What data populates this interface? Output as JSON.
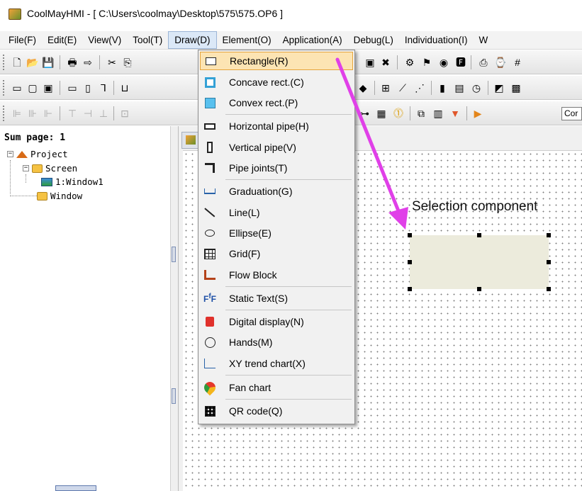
{
  "window": {
    "title": "CoolMayHMI - [ C:\\Users\\coolmay\\Desktop\\575\\575.OP6 ]"
  },
  "menubar": {
    "items": [
      {
        "label": "File(F)"
      },
      {
        "label": "Edit(E)"
      },
      {
        "label": "View(V)"
      },
      {
        "label": "Tool(T)"
      },
      {
        "label": "Draw(D)"
      },
      {
        "label": "Element(O)"
      },
      {
        "label": "Application(A)"
      },
      {
        "label": "Debug(L)"
      },
      {
        "label": "Individuation(I)"
      },
      {
        "label": "W"
      }
    ],
    "active": "Draw(D)"
  },
  "toolbar": {
    "combo_text": "Cor"
  },
  "tree": {
    "header": "Sum page: 1",
    "nodes": [
      {
        "label": "Project"
      },
      {
        "label": "Screen"
      },
      {
        "label": "1:Window1"
      },
      {
        "label": "Window"
      }
    ]
  },
  "draw_menu": {
    "items": [
      {
        "label": "Rectangle(R)",
        "icon": "rectangle-icon",
        "highlighted": true
      },
      {
        "label": "Concave rect.(C)",
        "icon": "concave-rect-icon"
      },
      {
        "label": "Convex rect.(P)",
        "icon": "convex-rect-icon"
      },
      {
        "label": "Horizontal pipe(H)",
        "icon": "horizontal-pipe-icon"
      },
      {
        "label": "Vertical pipe(V)",
        "icon": "vertical-pipe-icon"
      },
      {
        "label": "Pipe joints(T)",
        "icon": "pipe-joint-icon"
      },
      {
        "label": "Graduation(G)",
        "icon": "graduation-icon"
      },
      {
        "label": "Line(L)",
        "icon": "line-icon"
      },
      {
        "label": "Ellipse(E)",
        "icon": "ellipse-icon"
      },
      {
        "label": "Grid(F)",
        "icon": "grid-icon"
      },
      {
        "label": "Flow Block",
        "icon": "flow-block-icon"
      },
      {
        "label": "Static Text(S)",
        "icon": "static-text-icon"
      },
      {
        "label": "Digital display(N)",
        "icon": "digital-display-icon"
      },
      {
        "label": "Hands(M)",
        "icon": "hands-icon"
      },
      {
        "label": "XY trend chart(X)",
        "icon": "xy-trend-icon"
      },
      {
        "label": "Fan chart",
        "icon": "fan-chart-icon"
      },
      {
        "label": "QR code(Q)",
        "icon": "qr-code-icon"
      }
    ]
  },
  "canvas": {
    "annotation": "Selection component"
  },
  "colors": {
    "arrow": "#e040e8",
    "highlight": "#fce4b3",
    "selection_fill": "#ecebdc"
  }
}
